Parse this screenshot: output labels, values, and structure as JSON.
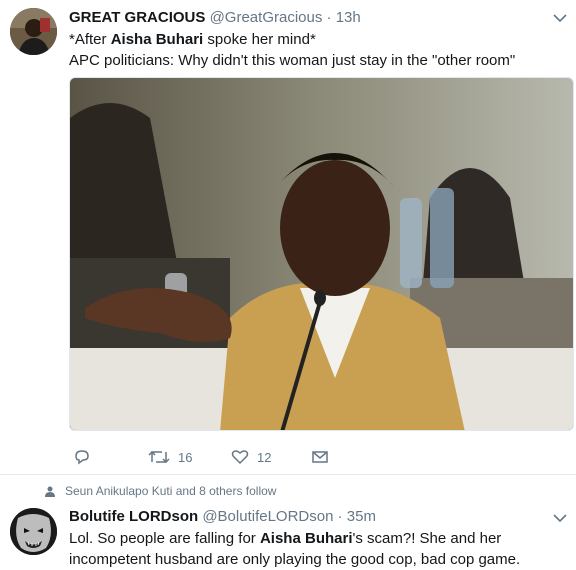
{
  "tweet1": {
    "author_name": "GREAT GRACIOUS",
    "author_handle": "@GreatGracious",
    "separator": "·",
    "time": "13h",
    "line1_before": "*After ",
    "line1_bold": "Aisha Buhari",
    "line1_after": " spoke her mind*",
    "line2": "APC politicians: Why didn't this woman just stay in the \"other room\"",
    "retweet_count": "16",
    "like_count": "12"
  },
  "social_context": {
    "text": "Seun Anikulapo Kuti and 8 others follow"
  },
  "tweet2": {
    "author_name": "Bolutife LORDson",
    "author_handle": "@BolutifeLORDson",
    "separator": "·",
    "time": "35m",
    "text_before": "Lol. So people are falling for ",
    "text_bold": "Aisha Buhari",
    "text_after": "'s scam?! She and her incompetent husband are only playing the good cop, bad cop game."
  },
  "colors": {
    "secondary_text": "#657786",
    "primary_text": "#14171a",
    "divider": "#e6ecf0"
  },
  "icons": [
    "reply-icon",
    "retweet-icon",
    "like-icon",
    "direct-message-icon",
    "chevron-down-icon",
    "person-icon"
  ]
}
